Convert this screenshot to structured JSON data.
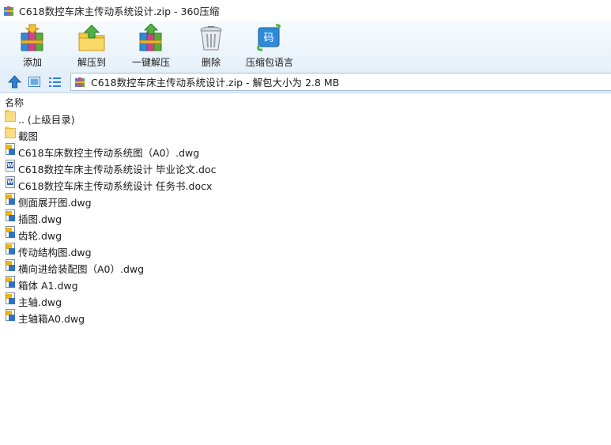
{
  "window": {
    "title": "C618数控车床主传动系统设计.zip - 360压缩"
  },
  "toolbar": {
    "add_label": "添加",
    "extract_to_label": "解压到",
    "one_click_extract_label": "一键解压",
    "delete_label": "删除",
    "encode_label": "压缩包语言",
    "encode_icon_glyph": "码"
  },
  "address": {
    "text": "C618数控车床主传动系统设计.zip - 解包大小为 2.8 MB"
  },
  "list": {
    "header_name": "名称",
    "items": [
      {
        "name": ".. (上级目录)",
        "type": "folder"
      },
      {
        "name": "截图",
        "type": "folder"
      },
      {
        "name": "C618车床数控主传动系统图（A0）.dwg",
        "type": "dwg"
      },
      {
        "name": "C618数控车床主传动系统设计 毕业论文.doc",
        "type": "doc"
      },
      {
        "name": "C618数控车床主传动系统设计 任务书.docx",
        "type": "doc"
      },
      {
        "name": "侧面展开图.dwg",
        "type": "dwg"
      },
      {
        "name": "插图.dwg",
        "type": "dwg"
      },
      {
        "name": "齿轮.dwg",
        "type": "dwg"
      },
      {
        "name": "传动结构图.dwg",
        "type": "dwg"
      },
      {
        "name": "横向进给装配图（A0）.dwg",
        "type": "dwg"
      },
      {
        "name": "箱体 A1.dwg",
        "type": "dwg"
      },
      {
        "name": "主轴.dwg",
        "type": "dwg"
      },
      {
        "name": "主轴箱A0.dwg",
        "type": "dwg"
      }
    ]
  },
  "colors": {
    "toolbar_gradient_top": "#f7fbfe",
    "toolbar_gradient_bottom": "#e5f0f9",
    "address_bar": "#e3eef8",
    "nav_blue": "#2f7fd6"
  },
  "icons": {
    "app": "winrar-books-icon",
    "add": "add-archive-icon",
    "extract_to": "extract-folder-icon",
    "one_click_extract": "one-click-extract-icon",
    "delete": "trash-bin-icon",
    "encode": "encoding-icon",
    "up": "up-arrow-icon",
    "thumbnail": "thumbnail-view-icon",
    "list": "list-view-icon"
  }
}
